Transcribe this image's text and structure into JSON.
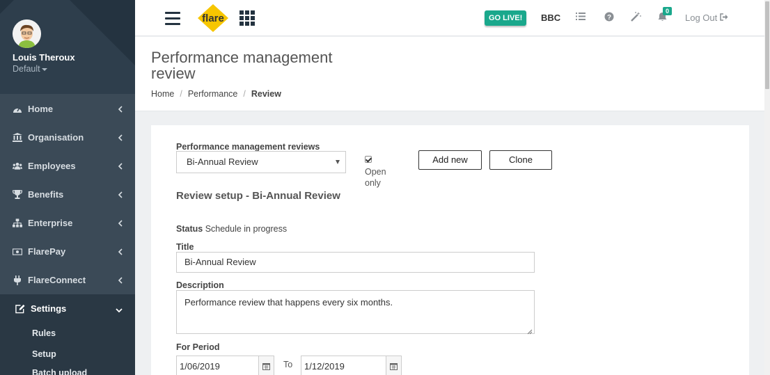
{
  "user": {
    "name": "Louis Theroux",
    "role": "Default"
  },
  "sidebar": {
    "items": [
      {
        "label": "Home",
        "icon": "dashboard-icon"
      },
      {
        "label": "Organisation",
        "icon": "institution-icon"
      },
      {
        "label": "Employees",
        "icon": "users-icon"
      },
      {
        "label": "Benefits",
        "icon": "trophy-icon"
      },
      {
        "label": "Enterprise",
        "icon": "sitemap-icon"
      },
      {
        "label": "FlarePay",
        "icon": "money-icon"
      },
      {
        "label": "FlareConnect",
        "icon": "plug-icon"
      },
      {
        "label": "Settings",
        "icon": "edit-icon",
        "active": true
      }
    ],
    "subitems": [
      {
        "label": "Rules"
      },
      {
        "label": "Setup"
      },
      {
        "label": "Batch upload"
      }
    ]
  },
  "topbar": {
    "logo_text": "flare",
    "go_live": "GO LIVE!",
    "company": "BBC",
    "notifications": "0",
    "logout": "Log Out"
  },
  "header": {
    "title": "Performance management review",
    "breadcrumb": [
      "Home",
      "Performance",
      "Review"
    ]
  },
  "form": {
    "reviews_label": "Performance management reviews",
    "selected_review": "Bi-Annual Review",
    "open_only_label": "Open only",
    "open_only_checked": true,
    "add_new": "Add new",
    "clone": "Clone",
    "section_title": "Review setup - Bi-Annual Review",
    "status_label": "Status",
    "status_value": "Schedule in progress",
    "title_label": "Title",
    "title_value": "Bi-Annual Review",
    "description_label": "Description",
    "description_value": "Performance review that happens every six months.",
    "period_label": "For Period",
    "period_from": "1/06/2019",
    "period_to_label": "To",
    "period_to": "1/12/2019"
  },
  "colors": {
    "sidebar_bg": "#3b4a57",
    "sidebar_dark": "#243340",
    "accent": "#1aa88c",
    "logo_yellow": "#f7c600"
  }
}
